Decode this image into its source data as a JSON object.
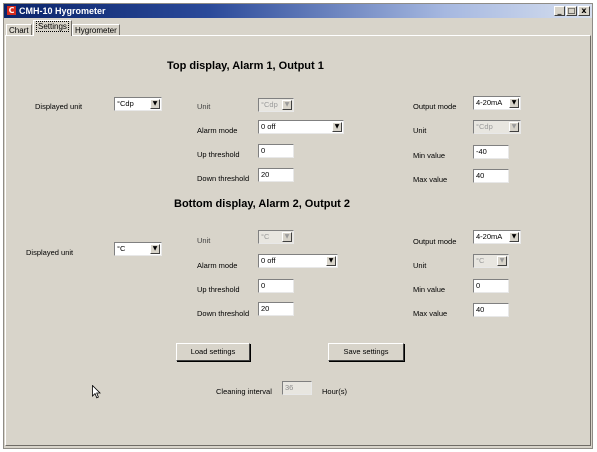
{
  "window": {
    "title": "CMH-10 Hygrometer",
    "icon_letter": "C",
    "controls": {
      "minimize": "_",
      "maximize": "□",
      "close": "x"
    }
  },
  "tabs": [
    {
      "label": "Chart"
    },
    {
      "label": "Settings"
    },
    {
      "label": "Hygrometer"
    }
  ],
  "active_tab": "Settings",
  "top": {
    "heading": "Top display, Alarm 1, Output 1",
    "displayed_unit": {
      "label": "Displayed unit",
      "value": "°Cdp"
    },
    "unit": {
      "label": "Unit",
      "value": "°Cdp"
    },
    "alarm_mode": {
      "label": "Alarm mode",
      "value": "0 off"
    },
    "up_threshold": {
      "label": "Up threshold",
      "value": "0"
    },
    "down_threshold": {
      "label": "Down threshold",
      "value": "20"
    },
    "output_mode": {
      "label": "Output mode",
      "value": "4-20mA"
    },
    "output_unit": {
      "label": "Unit",
      "value": "°Cdp"
    },
    "min_value": {
      "label": "Min value",
      "value": "-40"
    },
    "max_value": {
      "label": "Max value",
      "value": "40"
    }
  },
  "bottom": {
    "heading": "Bottom display, Alarm 2, Output 2",
    "displayed_unit": {
      "label": "Displayed unit",
      "value": "°C"
    },
    "unit": {
      "label": "Unit",
      "value": "°C"
    },
    "alarm_mode": {
      "label": "Alarm mode",
      "value": "0 off"
    },
    "up_threshold": {
      "label": "Up threshold",
      "value": "0"
    },
    "down_threshold": {
      "label": "Down threshold",
      "value": "20"
    },
    "output_mode": {
      "label": "Output mode",
      "value": "4-20mA"
    },
    "output_unit": {
      "label": "Unit",
      "value": "°C"
    },
    "min_value": {
      "label": "Min value",
      "value": "0"
    },
    "max_value": {
      "label": "Max value",
      "value": "40"
    }
  },
  "buttons": {
    "load": "Load settings",
    "save": "Save settings"
  },
  "cleaning": {
    "label": "Cleaning interval",
    "value": "36",
    "unit": "Hour(s)"
  },
  "icons": {
    "dropdown_arrow": "▼",
    "cursor": "arrow-cursor-icon"
  }
}
